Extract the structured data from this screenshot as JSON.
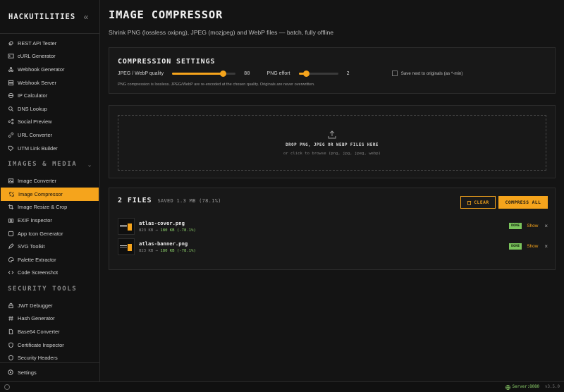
{
  "brand": {
    "name": "HACKUTILITIES"
  },
  "sidebar": {
    "top_items": [
      {
        "label": "REST API Tester",
        "icon": "rocket-icon"
      },
      {
        "label": "cURL Generator",
        "icon": "terminal-icon"
      },
      {
        "label": "Webhook Generator",
        "icon": "webhook-icon"
      },
      {
        "label": "Webhook Server",
        "icon": "server-icon"
      },
      {
        "label": "IP Calculator",
        "icon": "globe-icon"
      },
      {
        "label": "DNS Lookup",
        "icon": "search-icon"
      },
      {
        "label": "Social Preview",
        "icon": "share-icon"
      },
      {
        "label": "URL Converter",
        "icon": "link-icon"
      },
      {
        "label": "UTM Link Builder",
        "icon": "tag-icon"
      }
    ],
    "images_section": "IMAGES & MEDIA",
    "image_items": [
      {
        "label": "Image Converter",
        "icon": "image-icon"
      },
      {
        "label": "Image Compressor",
        "icon": "compress-icon",
        "active": true
      },
      {
        "label": "Image Resize & Crop",
        "icon": "crop-icon"
      },
      {
        "label": "EXIF Inspector",
        "icon": "camera-icon"
      },
      {
        "label": "App Icon Generator",
        "icon": "app-icon"
      },
      {
        "label": "SVG Toolkit",
        "icon": "pen-icon"
      },
      {
        "label": "Palette Extractor",
        "icon": "palette-icon"
      },
      {
        "label": "Code Screenshot",
        "icon": "code-icon"
      }
    ],
    "security_section": "SECURITY TOOLS",
    "security_items": [
      {
        "label": "JWT Debugger",
        "icon": "lock-icon"
      },
      {
        "label": "Hash Generator",
        "icon": "hash-icon"
      },
      {
        "label": "Base64 Converter",
        "icon": "file-icon"
      },
      {
        "label": "Certificate Inspector",
        "icon": "shield-icon"
      },
      {
        "label": "Security Headers",
        "icon": "shield-check-icon"
      }
    ],
    "settings_label": "Settings"
  },
  "page": {
    "title": "IMAGE COMPRESSOR",
    "subtitle": "Shrink PNG (lossless oxipng), JPEG (mozjpeg) and WebP files — batch, fully offline"
  },
  "settings": {
    "title": "COMPRESSION SETTINGS",
    "quality_label": "JPEG / WebP quality",
    "quality_value": "80",
    "quality_fraction": 0.8,
    "effort_label": "PNG effort",
    "effort_value": "2",
    "effort_fraction": 0.2,
    "save_next_label": "Save next to originals (as *-min)",
    "note": "PNG compression is lossless. JPEG/WebP are re-encoded at the chosen quality. Originals are never overwritten."
  },
  "dropzone": {
    "title": "DROP PNG, JPEG OR WEBP FILES HERE",
    "hint": "or click to browse (png, jpg, jpeg, webp)"
  },
  "files": {
    "count_label": "2 FILES",
    "saved_label": "SAVED 1.3 MB (78.1%)",
    "clear_label": "CLEAR",
    "compress_label": "COMPRESS ALL",
    "items": [
      {
        "name": "atlas-cover.png",
        "original": "823 KB",
        "arrow": "→",
        "compressed": "180 KB",
        "pct": "(-78.1%)",
        "status": "DONE",
        "show": "Show",
        "close": "×"
      },
      {
        "name": "atlas-banner.png",
        "original": "823 KB",
        "arrow": "→",
        "compressed": "180 KB",
        "pct": "(-78.1%)",
        "status": "DONE",
        "show": "Show",
        "close": "×"
      }
    ]
  },
  "statusbar": {
    "server": "Server:8080",
    "version": "v3.5.0"
  },
  "colors": {
    "accent": "#f5a41c",
    "success": "#7ac35c",
    "background": "#141414"
  }
}
